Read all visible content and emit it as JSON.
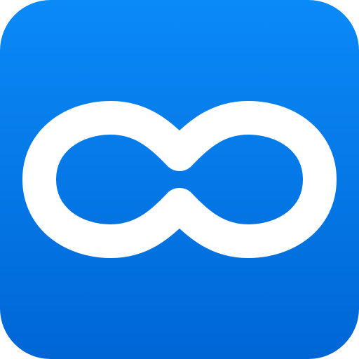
{
  "icon": {
    "name": "infinity-icon",
    "colors": {
      "gradient_top": "#0A8AF7",
      "gradient_bottom": "#0066D6",
      "symbol": "#FFFFFF"
    }
  }
}
